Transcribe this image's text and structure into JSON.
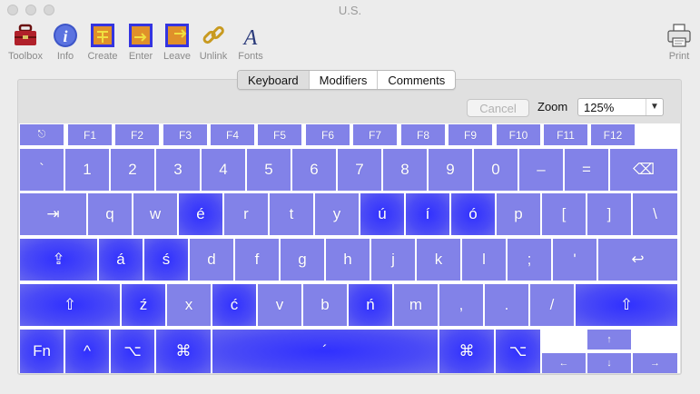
{
  "window": {
    "title": "U.S."
  },
  "toolbar": {
    "items": [
      {
        "label": "Toolbox",
        "icon": "toolbox-icon"
      },
      {
        "label": "Info",
        "icon": "info-icon"
      },
      {
        "label": "Create",
        "icon": "create-icon"
      },
      {
        "label": "Enter",
        "icon": "enter-icon"
      },
      {
        "label": "Leave",
        "icon": "leave-icon"
      },
      {
        "label": "Unlink",
        "icon": "unlink-icon"
      },
      {
        "label": "Fonts",
        "icon": "fonts-icon"
      }
    ],
    "print_label": "Print"
  },
  "tabs": {
    "keyboard": "Keyboard",
    "modifiers": "Modifiers",
    "comments": "Comments"
  },
  "controls": {
    "cancel_label": "Cancel",
    "zoom_label": "Zoom",
    "zoom_value": "125%"
  },
  "keyboard": {
    "rows": [
      [
        {
          "label": "⎋",
          "name": "escape"
        },
        {
          "label": "F1",
          "name": "f1"
        },
        {
          "label": "F2",
          "name": "f2"
        },
        {
          "label": "F3",
          "name": "f3"
        },
        {
          "label": "F4",
          "name": "f4"
        },
        {
          "label": "F5",
          "name": "f5"
        },
        {
          "label": "F6",
          "name": "f6"
        },
        {
          "label": "F7",
          "name": "f7"
        },
        {
          "label": "F8",
          "name": "f8"
        },
        {
          "label": "F9",
          "name": "f9"
        },
        {
          "label": "F10",
          "name": "f10"
        },
        {
          "label": "F11",
          "name": "f11"
        },
        {
          "label": "F12",
          "name": "f12"
        }
      ],
      [
        {
          "label": "`",
          "name": "backtick"
        },
        {
          "label": "1",
          "name": "1"
        },
        {
          "label": "2",
          "name": "2"
        },
        {
          "label": "3",
          "name": "3"
        },
        {
          "label": "4",
          "name": "4"
        },
        {
          "label": "5",
          "name": "5"
        },
        {
          "label": "6",
          "name": "6"
        },
        {
          "label": "7",
          "name": "7"
        },
        {
          "label": "8",
          "name": "8"
        },
        {
          "label": "9",
          "name": "9"
        },
        {
          "label": "0",
          "name": "0"
        },
        {
          "label": "–",
          "name": "minus"
        },
        {
          "label": "=",
          "name": "equals"
        },
        {
          "label": "⌫",
          "name": "delete"
        }
      ],
      [
        {
          "label": "⇥",
          "name": "tab"
        },
        {
          "label": "q",
          "name": "q"
        },
        {
          "label": "w",
          "name": "w"
        },
        {
          "label": "é",
          "name": "e",
          "hot": true
        },
        {
          "label": "r",
          "name": "r"
        },
        {
          "label": "t",
          "name": "t"
        },
        {
          "label": "y",
          "name": "y"
        },
        {
          "label": "ú",
          "name": "u",
          "hot": true
        },
        {
          "label": "í",
          "name": "i",
          "hot": true
        },
        {
          "label": "ó",
          "name": "o",
          "hot": true
        },
        {
          "label": "p",
          "name": "p"
        },
        {
          "label": "[",
          "name": "left-bracket"
        },
        {
          "label": "]",
          "name": "right-bracket"
        },
        {
          "label": "\\",
          "name": "backslash"
        }
      ],
      [
        {
          "label": "⇪",
          "name": "caps-lock",
          "hot": true
        },
        {
          "label": "á",
          "name": "a",
          "hot": true
        },
        {
          "label": "ś",
          "name": "s",
          "hot": true
        },
        {
          "label": "d",
          "name": "d"
        },
        {
          "label": "f",
          "name": "f"
        },
        {
          "label": "g",
          "name": "g"
        },
        {
          "label": "h",
          "name": "h"
        },
        {
          "label": "j",
          "name": "j"
        },
        {
          "label": "k",
          "name": "k"
        },
        {
          "label": "l",
          "name": "l"
        },
        {
          "label": ";",
          "name": "semicolon"
        },
        {
          "label": "'",
          "name": "quote"
        },
        {
          "label": "↩",
          "name": "return"
        }
      ],
      [
        {
          "label": "⇧",
          "name": "left-shift",
          "hot": true
        },
        {
          "label": "ź",
          "name": "z",
          "hot": true
        },
        {
          "label": "x",
          "name": "x"
        },
        {
          "label": "ć",
          "name": "c",
          "hot": true
        },
        {
          "label": "v",
          "name": "v"
        },
        {
          "label": "b",
          "name": "b"
        },
        {
          "label": "ń",
          "name": "n",
          "hot": true
        },
        {
          "label": "m",
          "name": "m"
        },
        {
          "label": ",",
          "name": "comma"
        },
        {
          "label": ".",
          "name": "period"
        },
        {
          "label": "/",
          "name": "slash"
        },
        {
          "label": "⇧",
          "name": "right-shift",
          "hot": true
        }
      ],
      [
        {
          "label": "Fn",
          "name": "fn",
          "hot": true
        },
        {
          "label": "^",
          "name": "control",
          "hot": true
        },
        {
          "label": "⌥",
          "name": "left-option",
          "hot": true
        },
        {
          "label": "⌘",
          "name": "left-command",
          "hot": true
        },
        {
          "label": "´",
          "name": "space",
          "hot": true
        },
        {
          "label": "⌘",
          "name": "right-command",
          "hot": true
        },
        {
          "label": "⌥",
          "name": "right-option",
          "hot": true
        }
      ]
    ],
    "arrows": [
      {
        "label": "↑",
        "name": "arrow-up"
      },
      {
        "label": "←",
        "name": "arrow-left"
      },
      {
        "label": "↓",
        "name": "arrow-down"
      },
      {
        "label": "→",
        "name": "arrow-right"
      }
    ]
  }
}
